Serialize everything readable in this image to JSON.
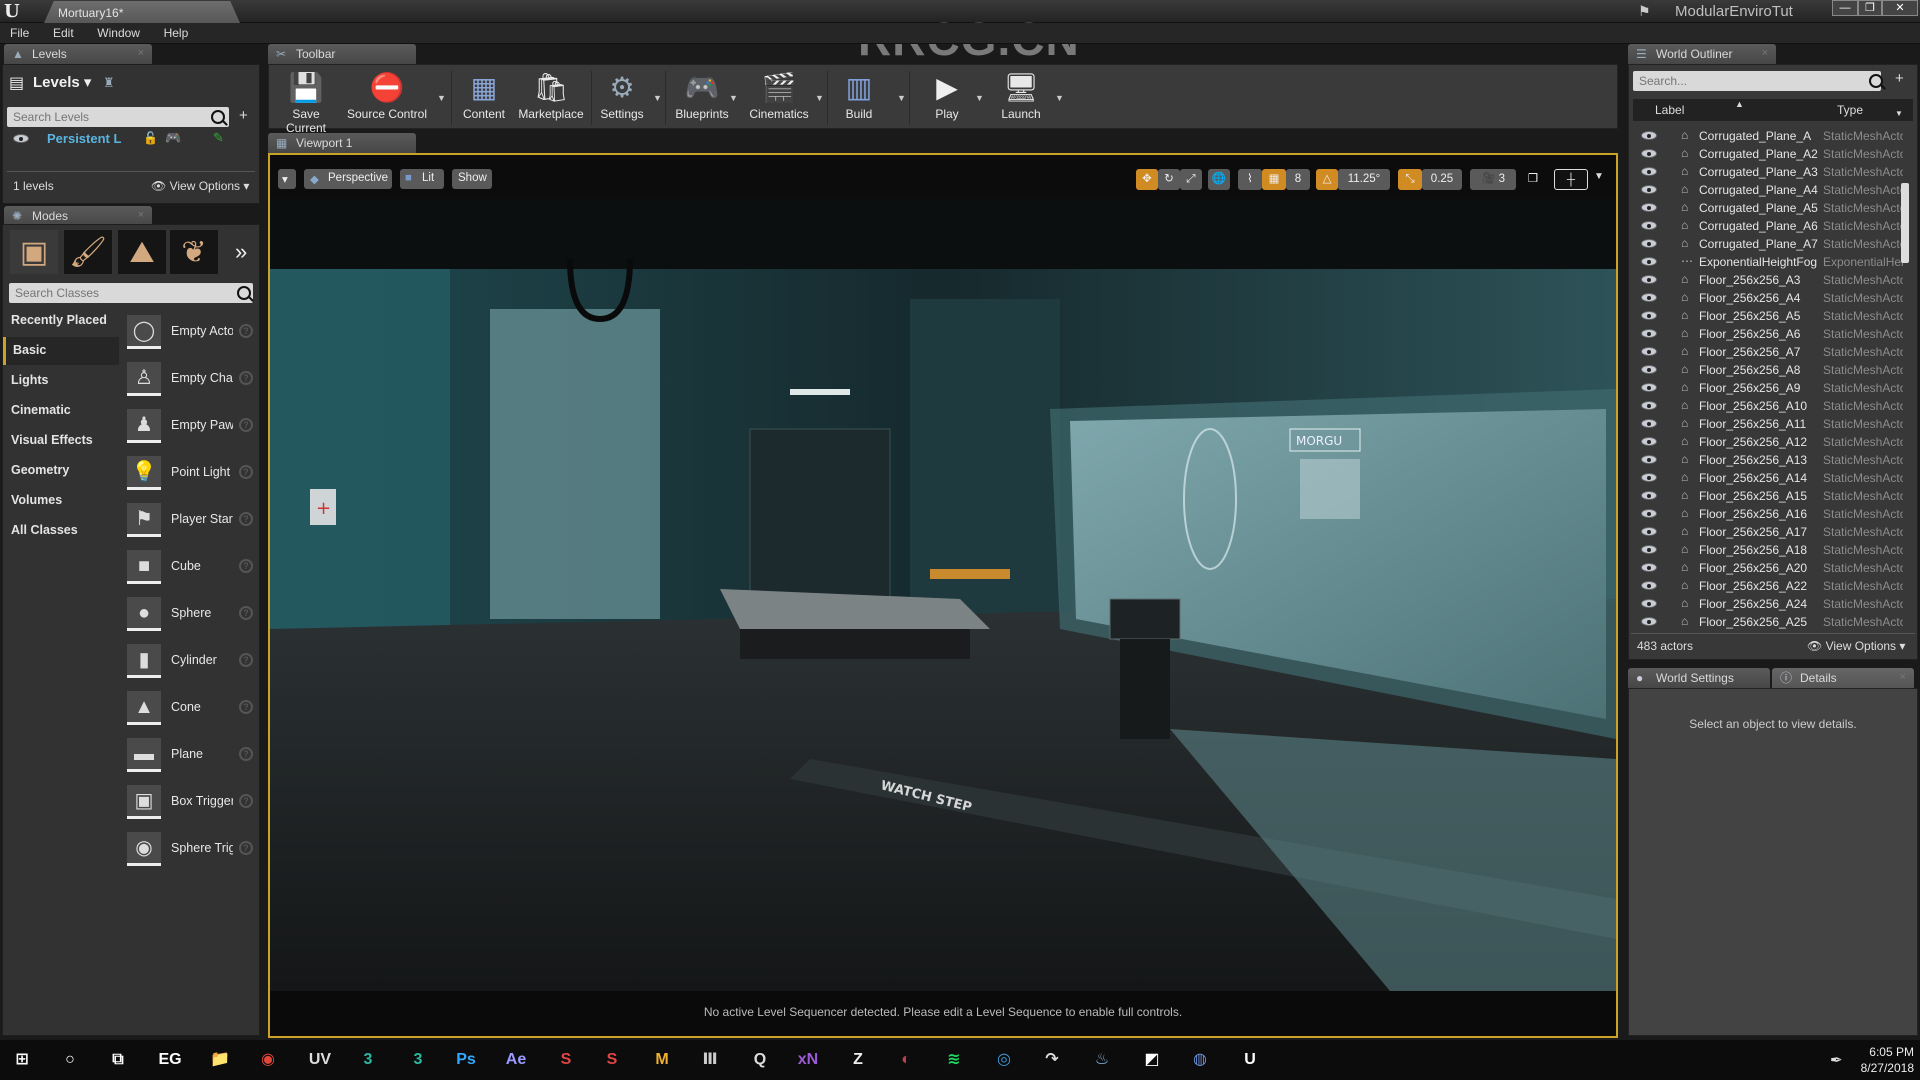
{
  "window": {
    "document_tab": "Mortuary16*",
    "project_name": "ModularEnviroTut",
    "watermark": "RRCG.CN",
    "controls": [
      "minimize",
      "restore",
      "close"
    ]
  },
  "menu": [
    "File",
    "Edit",
    "Window",
    "Help"
  ],
  "levels_panel": {
    "tab_label": "Levels",
    "header": "Levels",
    "search_placeholder": "Search Levels",
    "levels": [
      {
        "name": "Persistent L"
      }
    ],
    "count_label": "1 levels",
    "view_options": "View Options"
  },
  "modes_panel": {
    "tab_label": "Modes",
    "mode_icons": [
      "place-mode-icon",
      "paint-mode-icon",
      "landscape-mode-icon",
      "foliage-mode-icon"
    ],
    "search_placeholder": "Search Classes",
    "categories": [
      "Recently Placed",
      "Basic",
      "Lights",
      "Cinematic",
      "Visual Effects",
      "Geometry",
      "Volumes",
      "All Classes"
    ],
    "active_category": "Basic",
    "items": [
      {
        "label": "Empty Actor",
        "icon": "◯"
      },
      {
        "label": "Empty Character",
        "icon": "♙"
      },
      {
        "label": "Empty Pawn",
        "icon": "♟"
      },
      {
        "label": "Point Light",
        "icon": "💡"
      },
      {
        "label": "Player Start",
        "icon": "⚑"
      },
      {
        "label": "Cube",
        "icon": "■"
      },
      {
        "label": "Sphere",
        "icon": "●"
      },
      {
        "label": "Cylinder",
        "icon": "▮"
      },
      {
        "label": "Cone",
        "icon": "▲"
      },
      {
        "label": "Plane",
        "icon": "▬"
      },
      {
        "label": "Box Trigger",
        "icon": "▣"
      },
      {
        "label": "Sphere Trigger",
        "icon": "◉"
      }
    ]
  },
  "toolbar": {
    "tab_label": "Toolbar",
    "buttons": [
      {
        "label": "Save Current",
        "icon": "💾"
      },
      {
        "label": "Source Control",
        "icon": "⛔"
      },
      {
        "label": "Content",
        "icon": "▦"
      },
      {
        "label": "Marketplace",
        "icon": "🛍"
      },
      {
        "label": "Settings",
        "icon": "⚙"
      },
      {
        "label": "Blueprints",
        "icon": "🎮"
      },
      {
        "label": "Cinematics",
        "icon": "🎬"
      },
      {
        "label": "Build",
        "icon": "▥"
      },
      {
        "label": "Play",
        "icon": "▶"
      },
      {
        "label": "Launch",
        "icon": "🖥"
      }
    ]
  },
  "viewport": {
    "tab_label": "Viewport 1",
    "view_mode": "Perspective",
    "lighting": "Lit",
    "show": "Show",
    "grid_snap": "8",
    "rotation_snap": "11.25°",
    "scale_snap": "0.25",
    "camera_speed": "3",
    "status_message": "No active Level Sequencer detected. Please edit a Level Sequence to enable full controls.",
    "scene_sign": "MORGU",
    "floor_text": "WATCH STEP"
  },
  "world_outliner": {
    "tab_label": "World Outliner",
    "search_placeholder": "Search...",
    "columns": [
      "Label",
      "Type"
    ],
    "rows": [
      {
        "label": "Corrugated_Plane_A",
        "type": "StaticMeshActor"
      },
      {
        "label": "Corrugated_Plane_A2",
        "type": "StaticMeshActor"
      },
      {
        "label": "Corrugated_Plane_A3",
        "type": "StaticMeshActor"
      },
      {
        "label": "Corrugated_Plane_A4",
        "type": "StaticMeshActor"
      },
      {
        "label": "Corrugated_Plane_A5",
        "type": "StaticMeshActor"
      },
      {
        "label": "Corrugated_Plane_A6",
        "type": "StaticMeshActor"
      },
      {
        "label": "Corrugated_Plane_A7",
        "type": "StaticMeshActor"
      },
      {
        "label": "ExponentialHeightFog",
        "type": "ExponentialHeightFog"
      },
      {
        "label": "Floor_256x256_A3",
        "type": "StaticMeshActor"
      },
      {
        "label": "Floor_256x256_A4",
        "type": "StaticMeshActor"
      },
      {
        "label": "Floor_256x256_A5",
        "type": "StaticMeshActor"
      },
      {
        "label": "Floor_256x256_A6",
        "type": "StaticMeshActor"
      },
      {
        "label": "Floor_256x256_A7",
        "type": "StaticMeshActor"
      },
      {
        "label": "Floor_256x256_A8",
        "type": "StaticMeshActor"
      },
      {
        "label": "Floor_256x256_A9",
        "type": "StaticMeshActor"
      },
      {
        "label": "Floor_256x256_A10",
        "type": "StaticMeshActor"
      },
      {
        "label": "Floor_256x256_A11",
        "type": "StaticMeshActor"
      },
      {
        "label": "Floor_256x256_A12",
        "type": "StaticMeshActor"
      },
      {
        "label": "Floor_256x256_A13",
        "type": "StaticMeshActor"
      },
      {
        "label": "Floor_256x256_A14",
        "type": "StaticMeshActor"
      },
      {
        "label": "Floor_256x256_A15",
        "type": "StaticMeshActor"
      },
      {
        "label": "Floor_256x256_A16",
        "type": "StaticMeshActor"
      },
      {
        "label": "Floor_256x256_A17",
        "type": "StaticMeshActor"
      },
      {
        "label": "Floor_256x256_A18",
        "type": "StaticMeshActor"
      },
      {
        "label": "Floor_256x256_A20",
        "type": "StaticMeshActor"
      },
      {
        "label": "Floor_256x256_A22",
        "type": "StaticMeshActor"
      },
      {
        "label": "Floor_256x256_A24",
        "type": "StaticMeshActor"
      },
      {
        "label": "Floor_256x256_A25",
        "type": "StaticMeshActor"
      }
    ],
    "actor_count": "483 actors",
    "view_options": "View Options"
  },
  "details_panel": {
    "tabs": [
      "World Settings",
      "Details"
    ],
    "empty_message": "Select an object to view details."
  },
  "taskbar": {
    "apps": [
      {
        "name": "start",
        "glyph": "⊞",
        "color": "#ffffff"
      },
      {
        "name": "cortana",
        "glyph": "○",
        "color": "#ffffff"
      },
      {
        "name": "task-view",
        "glyph": "⧉",
        "color": "#ffffff"
      },
      {
        "name": "epic-games",
        "glyph": "EG",
        "color": "#ffffff"
      },
      {
        "name": "file-explorer",
        "glyph": "📁",
        "color": "#f3c94e"
      },
      {
        "name": "chrome",
        "glyph": "◉",
        "color": "#e0463a"
      },
      {
        "name": "uv-layout",
        "glyph": "UV",
        "color": "#dddddd"
      },
      {
        "name": "3ds-max-1",
        "glyph": "3",
        "color": "#2bb8a0"
      },
      {
        "name": "3ds-max-2",
        "glyph": "3",
        "color": "#2bb8a0"
      },
      {
        "name": "photoshop",
        "glyph": "Ps",
        "color": "#31a8ff"
      },
      {
        "name": "after-effects",
        "glyph": "Ae",
        "color": "#9999ff"
      },
      {
        "name": "substance-painter",
        "glyph": "S",
        "color": "#e04545"
      },
      {
        "name": "substance-designer",
        "glyph": "S",
        "color": "#e04545"
      },
      {
        "name": "marmoset",
        "glyph": "M",
        "color": "#f0b230"
      },
      {
        "name": "trim-tool",
        "glyph": "Ⅲ",
        "color": "#cccccc"
      },
      {
        "name": "quixel",
        "glyph": "Q",
        "color": "#dddddd"
      },
      {
        "name": "xnormal",
        "glyph": "xN",
        "color": "#9b5bd6"
      },
      {
        "name": "zbrush",
        "glyph": "Z",
        "color": "#eeeeee"
      },
      {
        "name": "media",
        "glyph": "◐",
        "color": "#c04050"
      },
      {
        "name": "spotify",
        "glyph": "≋",
        "color": "#1ed760"
      },
      {
        "name": "sharex",
        "glyph": "◎",
        "color": "#3c9ee0"
      },
      {
        "name": "arrow-tool",
        "glyph": "↷",
        "color": "#dddddd"
      },
      {
        "name": "steam",
        "glyph": "♨",
        "color": "#8bb6e0"
      },
      {
        "name": "notepad",
        "glyph": "◩",
        "color": "#ffffff"
      },
      {
        "name": "obs",
        "glyph": "◍",
        "color": "#6d8fd8"
      },
      {
        "name": "unreal-engine",
        "glyph": "U",
        "color": "#ffffff"
      }
    ],
    "time": "6:05 PM",
    "date": "8/27/2018"
  }
}
